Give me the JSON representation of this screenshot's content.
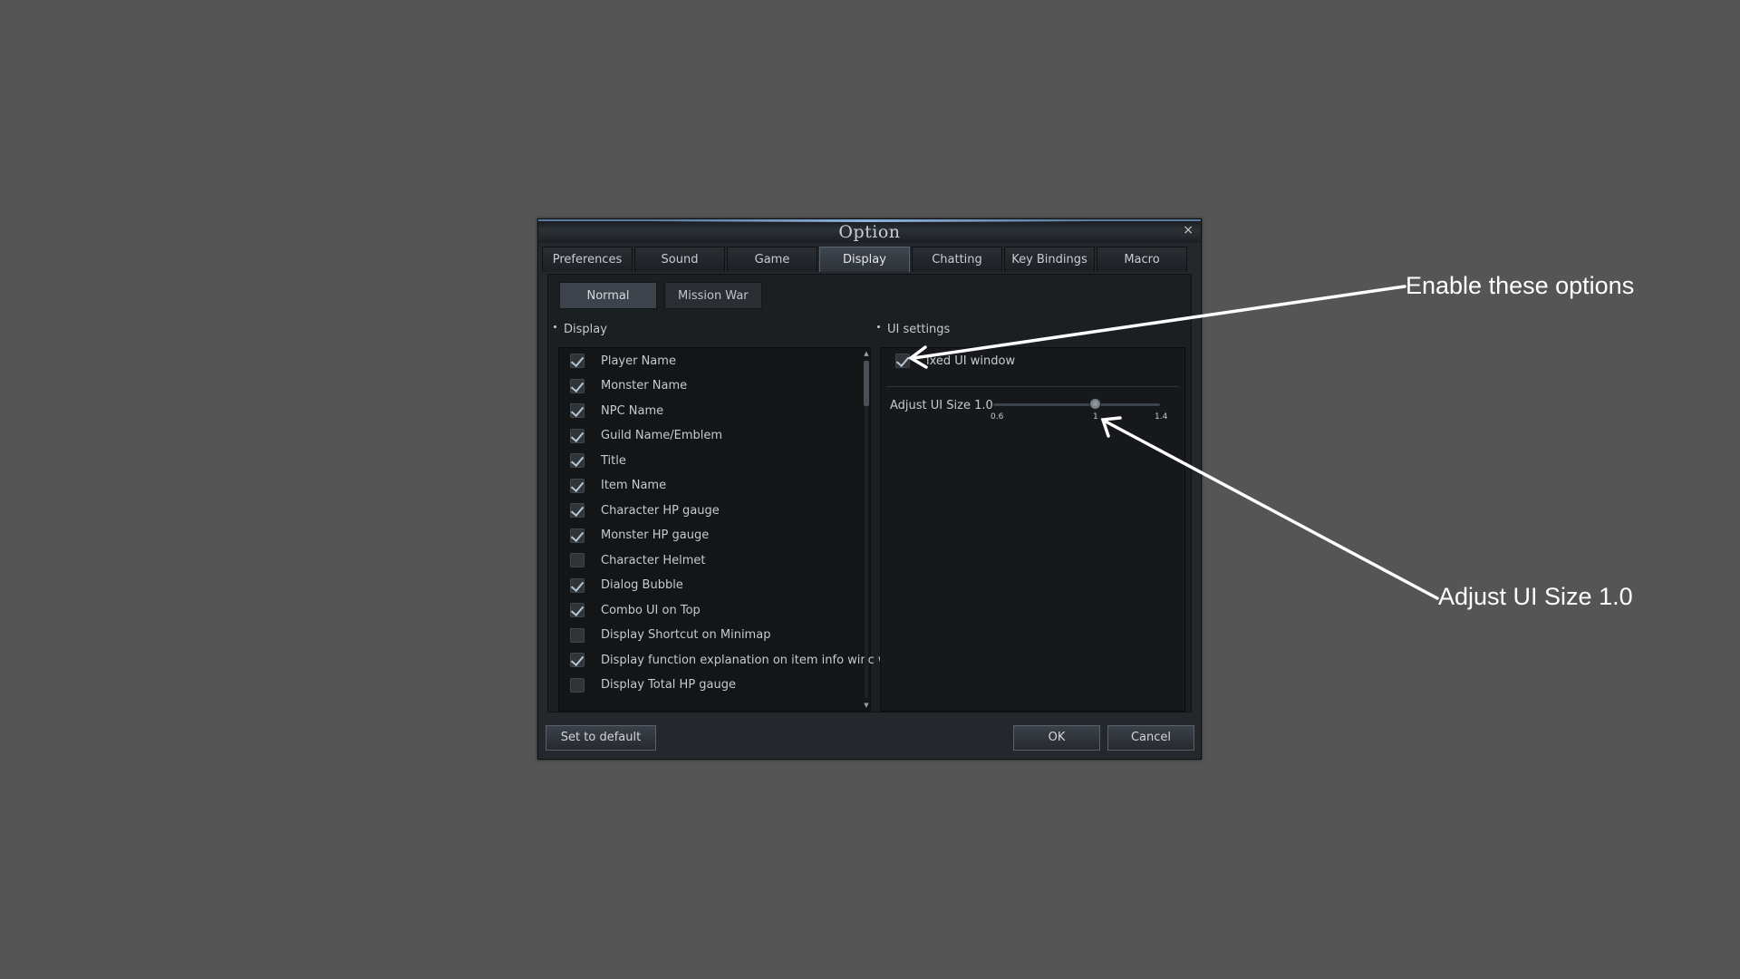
{
  "window": {
    "title": "Option",
    "close_glyph": "×"
  },
  "tabs": [
    {
      "label": "Preferences"
    },
    {
      "label": "Sound"
    },
    {
      "label": "Game"
    },
    {
      "label": "Display",
      "active": true
    },
    {
      "label": "Chatting"
    },
    {
      "label": "Key Bindings"
    },
    {
      "label": "Macro"
    }
  ],
  "subtabs": [
    {
      "label": "Normal",
      "active": true
    },
    {
      "label": "Mission War"
    }
  ],
  "display_section": {
    "label": "Display",
    "items": [
      {
        "label": "Player Name",
        "checked": true
      },
      {
        "label": "Monster Name",
        "checked": true
      },
      {
        "label": "NPC Name",
        "checked": true
      },
      {
        "label": "Guild Name/Emblem",
        "checked": true
      },
      {
        "label": "Title",
        "checked": true
      },
      {
        "label": "Item Name",
        "checked": true
      },
      {
        "label": "Character HP gauge",
        "checked": true
      },
      {
        "label": "Monster HP gauge",
        "checked": true
      },
      {
        "label": "Character Helmet",
        "checked": false
      },
      {
        "label": "Dialog Bubble",
        "checked": true
      },
      {
        "label": "Combo UI on Top",
        "checked": true
      },
      {
        "label": "Display Shortcut on Minimap",
        "checked": false
      },
      {
        "label": "Display function explanation on item info winc  w",
        "checked": true
      },
      {
        "label": "Display Total HP gauge",
        "checked": false
      }
    ]
  },
  "ui_section": {
    "label": "UI settings",
    "fixed_ui": {
      "label": "ixed UI window",
      "checked": true
    },
    "slider": {
      "label": "Adjust UI Size  1.0",
      "value": 1.0,
      "min": 0.6,
      "max": 1.4,
      "tick_min": "0.6",
      "tick_mid": "1",
      "tick_max": "1.4"
    }
  },
  "buttons": {
    "default": "Set to default",
    "ok": "OK",
    "cancel": "Cancel"
  },
  "annotations": {
    "enable": "Enable these options",
    "adjust": "Adjust UI Size 1.0"
  }
}
